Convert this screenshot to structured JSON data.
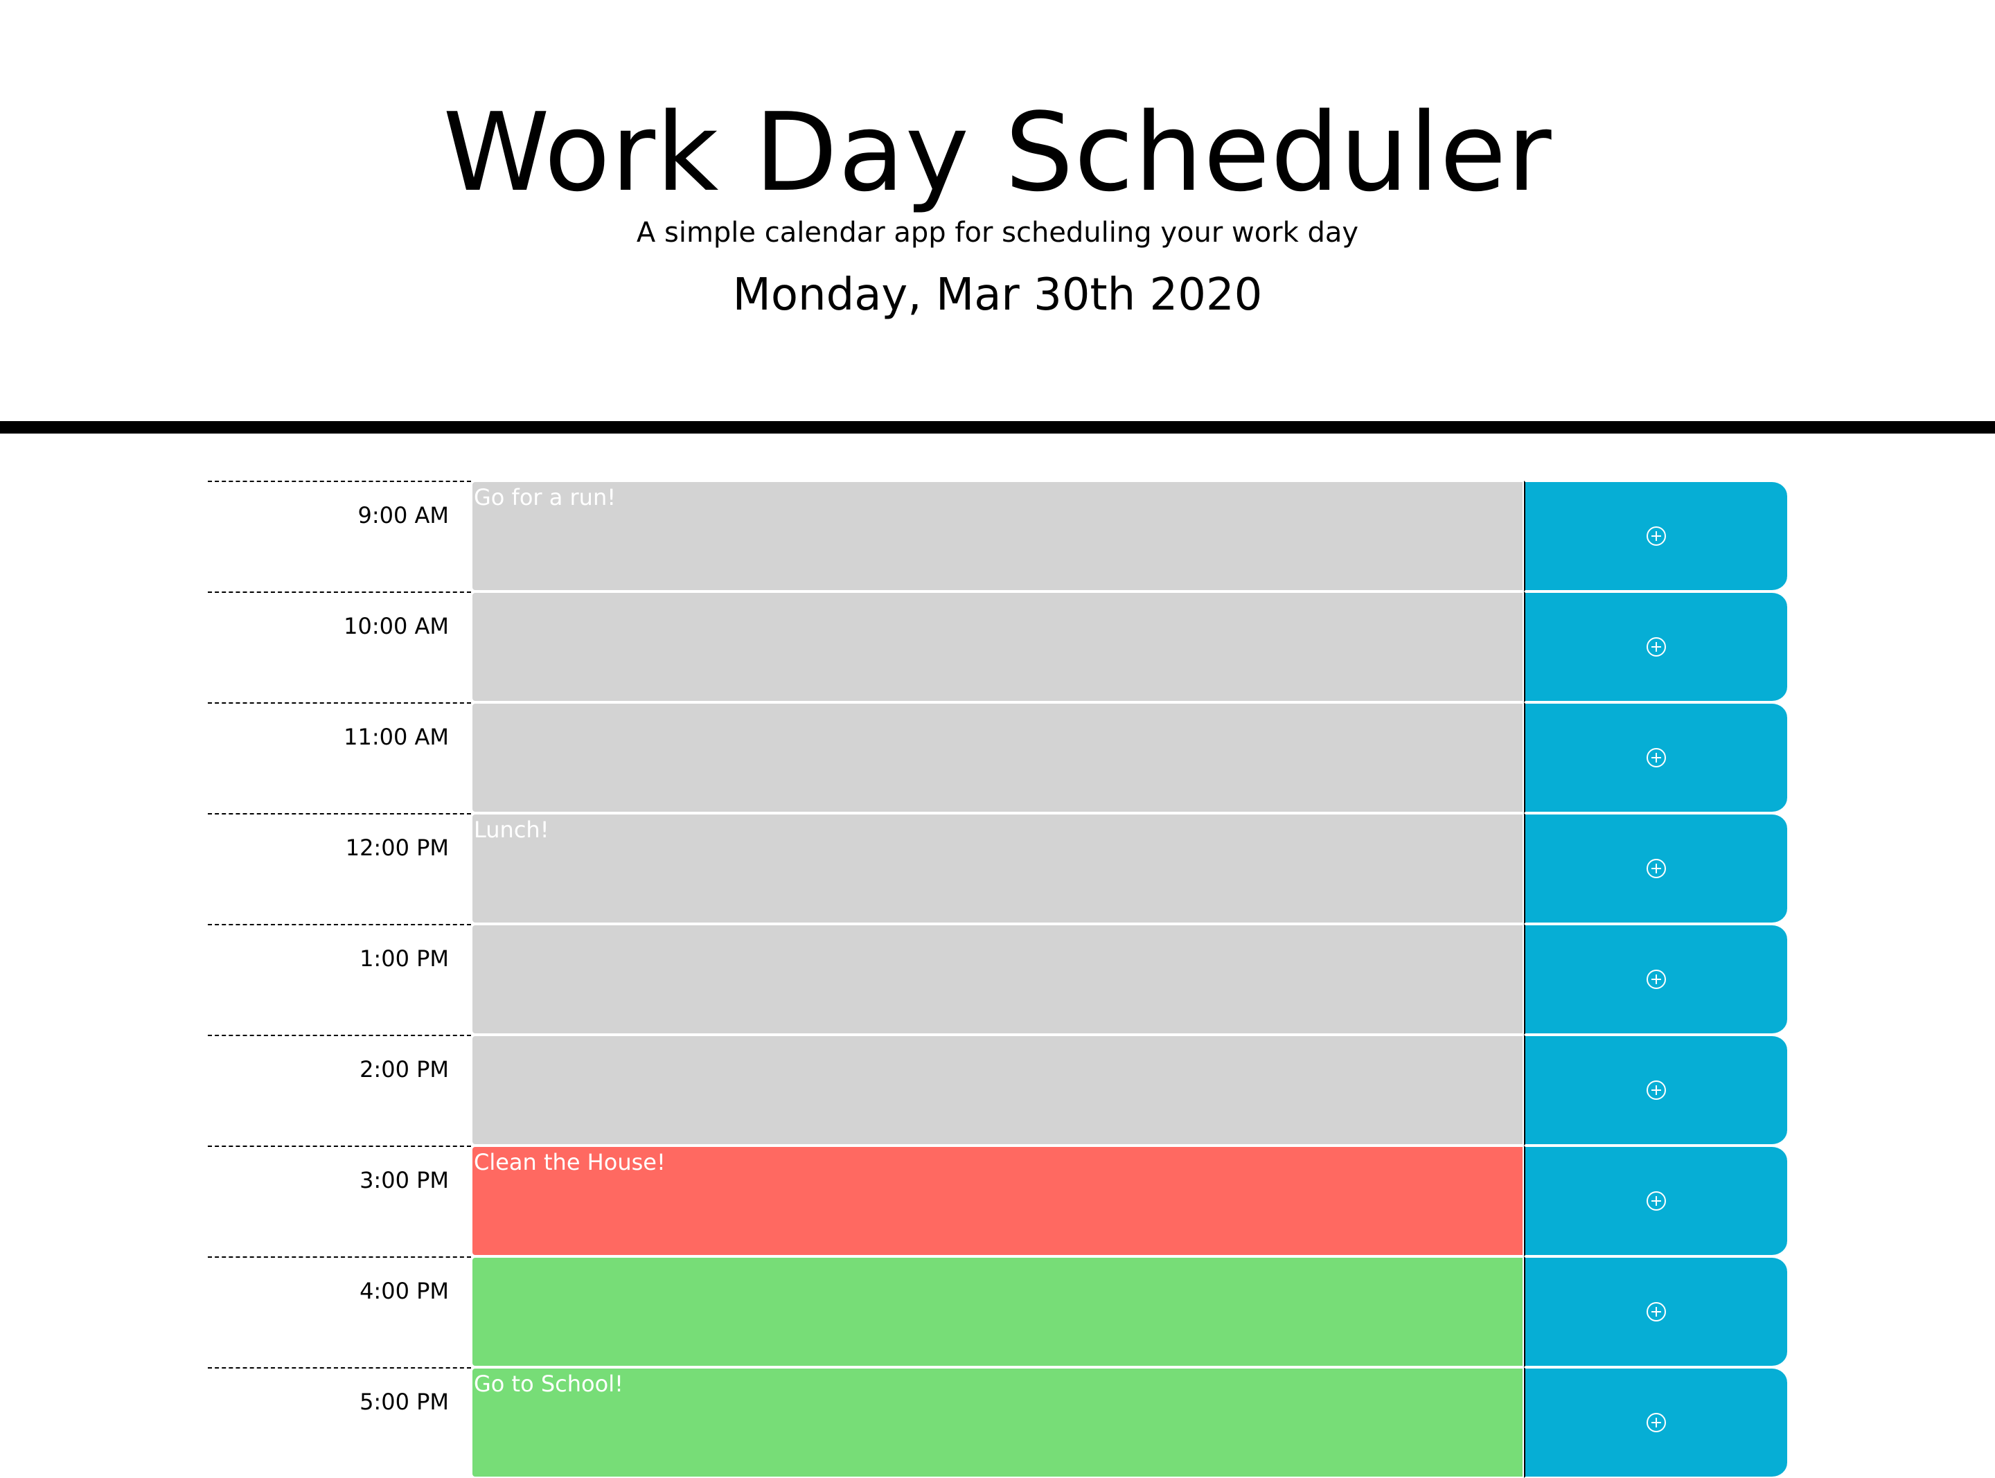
{
  "header": {
    "title": "Work Day Scheduler",
    "subtitle": "A simple calendar app for scheduling your work day",
    "current_date": "Monday, Mar 30th 2020"
  },
  "colors": {
    "past": "#d3d3d3",
    "present": "#ff6961",
    "future": "#77dd77",
    "save_button": "#06aed5"
  },
  "rows": [
    {
      "hour": "9:00 AM",
      "task": "Go for a run!",
      "status": "past",
      "icon": "plus-circle-icon"
    },
    {
      "hour": "10:00 AM",
      "task": "",
      "status": "past",
      "icon": "plus-circle-icon"
    },
    {
      "hour": "11:00 AM",
      "task": "",
      "status": "past",
      "icon": "plus-circle-icon"
    },
    {
      "hour": "12:00 PM",
      "task": "Lunch!",
      "status": "past",
      "icon": "plus-circle-icon"
    },
    {
      "hour": "1:00 PM",
      "task": "",
      "status": "past",
      "icon": "plus-circle-icon"
    },
    {
      "hour": "2:00 PM",
      "task": "",
      "status": "past",
      "icon": "plus-circle-icon"
    },
    {
      "hour": "3:00 PM",
      "task": "Clean the House!",
      "status": "present",
      "icon": "plus-circle-icon"
    },
    {
      "hour": "4:00 PM",
      "task": "",
      "status": "future",
      "icon": "plus-circle-icon"
    },
    {
      "hour": "5:00 PM",
      "task": "Go to School!",
      "status": "future",
      "icon": "plus-circle-icon"
    }
  ]
}
